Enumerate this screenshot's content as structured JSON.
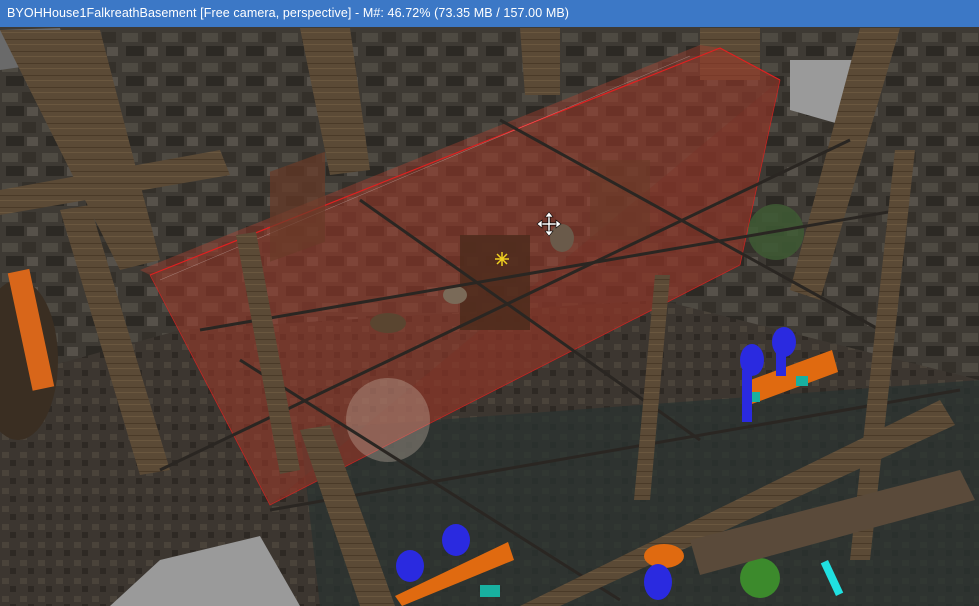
{
  "window": {
    "title": "BYOHHouse1FalkreathBasement [Free camera, perspective] - M#: 46.72% (73.35 MB / 157.00 MB)"
  },
  "viewport": {
    "camera_mode": "Free camera, perspective",
    "cursor_icon": "move-cursor-icon",
    "marker_icon": "light-marker-icon"
  },
  "colors": {
    "titlebar": "#3c78c6",
    "selection_outline": "#e02020",
    "selection_fill": "#a03a2a",
    "actor_marker": "#2a2ae0",
    "furniture_marker": "#e06a10",
    "idle_marker": "#18b0a0"
  }
}
